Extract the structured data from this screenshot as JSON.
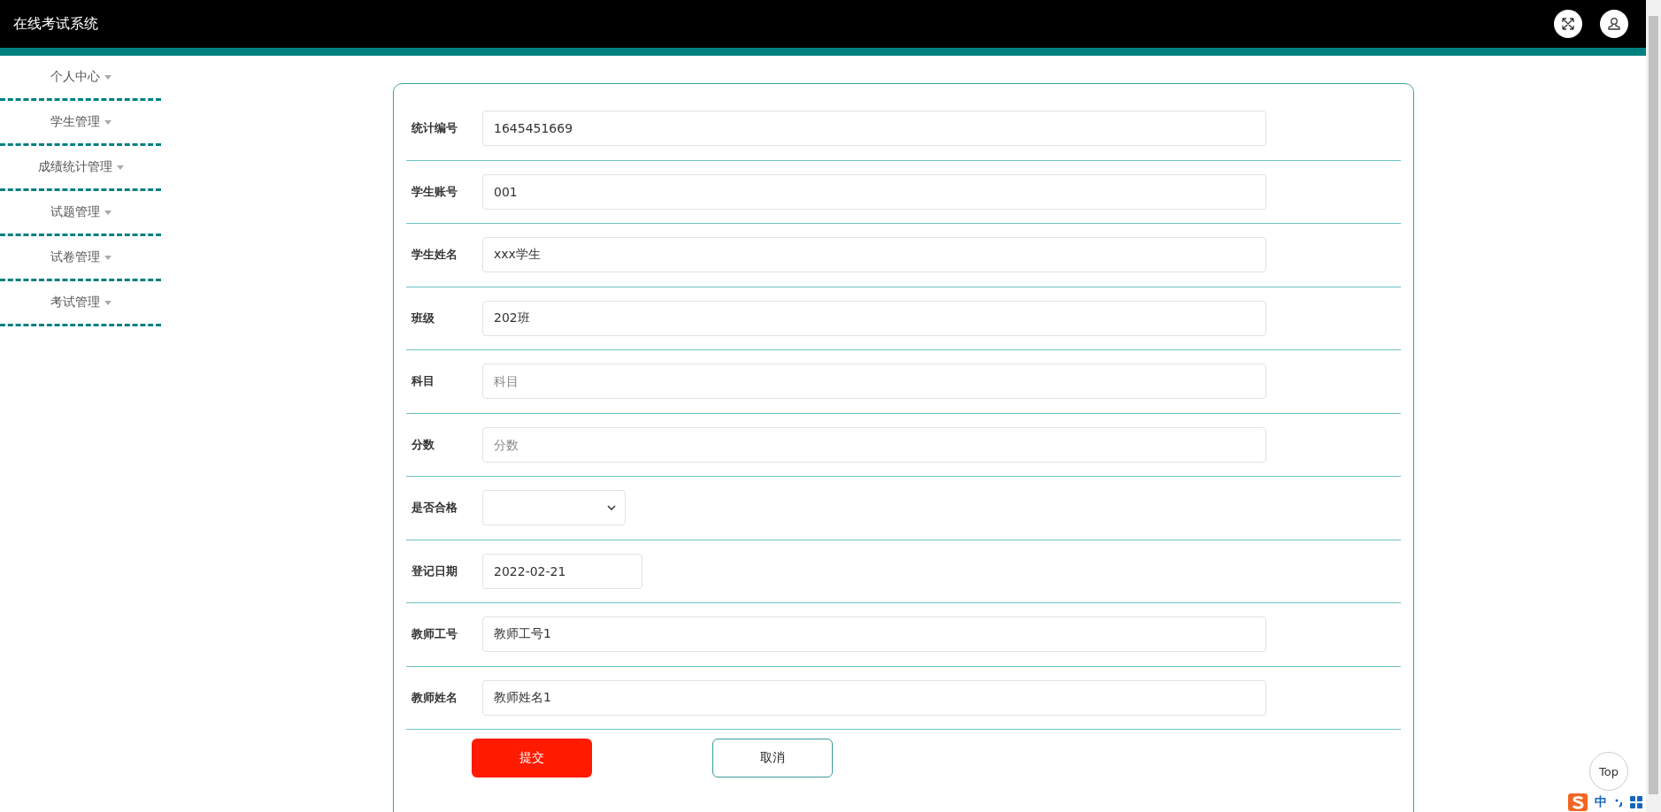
{
  "header": {
    "title": "在线考试系统"
  },
  "sidebar": {
    "items": [
      {
        "label": "个人中心",
        "expanded": false
      },
      {
        "label": "学生管理",
        "expanded": false
      },
      {
        "label": "成绩统计管理",
        "expanded": false
      },
      {
        "label": "试题管理",
        "expanded": false
      },
      {
        "label": "试卷管理",
        "expanded": false
      },
      {
        "label": "考试管理",
        "expanded": false
      }
    ]
  },
  "form": {
    "fields": [
      {
        "kind": "text",
        "label": "统计编号",
        "value": "1645451669"
      },
      {
        "kind": "text",
        "label": "学生账号",
        "value": "001"
      },
      {
        "kind": "text",
        "label": "学生姓名",
        "value": "xxx学生"
      },
      {
        "kind": "text",
        "label": "班级",
        "value": "202班"
      },
      {
        "kind": "text",
        "label": "科目",
        "placeholder": "科目"
      },
      {
        "kind": "text",
        "label": "分数",
        "placeholder": "分数"
      },
      {
        "kind": "select",
        "label": "是否合格"
      },
      {
        "kind": "date",
        "label": "登记日期",
        "value": "2022-02-21"
      },
      {
        "kind": "text",
        "label": "教师工号",
        "value": "教师工号1"
      },
      {
        "kind": "text",
        "label": "教师姓名",
        "value": "教师姓名1"
      }
    ],
    "buttons": [
      {
        "kind": "primary",
        "label": "提交"
      },
      {
        "kind": "secondary",
        "label": "取消"
      }
    ]
  },
  "back_to_top": "Top",
  "ime_bar": {
    "mode": "中"
  }
}
